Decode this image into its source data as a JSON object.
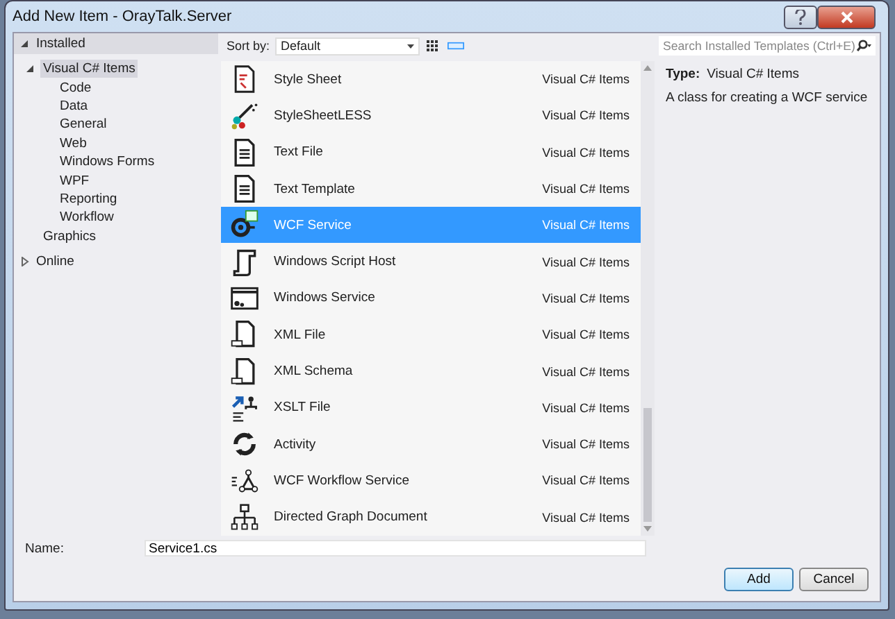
{
  "window": {
    "title": "Add New Item - OrayTalk.Server"
  },
  "sidebar": {
    "sections": [
      {
        "label": "Installed",
        "expanded": true,
        "items": [
          {
            "label": "Visual C# Items",
            "selected": true,
            "expanded": true,
            "children": [
              {
                "label": "Code",
                "selected": false
              },
              {
                "label": "Data",
                "selected": false
              },
              {
                "label": "General",
                "selected": false
              },
              {
                "label": "Web",
                "selected": false
              },
              {
                "label": "Windows Forms",
                "selected": false
              },
              {
                "label": "WPF",
                "selected": false
              },
              {
                "label": "Reporting",
                "selected": false
              },
              {
                "label": "Workflow",
                "selected": false
              }
            ]
          },
          {
            "label": "Graphics",
            "selected": false
          }
        ]
      },
      {
        "label": "Online",
        "expanded": false
      }
    ]
  },
  "toolbar": {
    "sort_label": "Sort by:",
    "sort_value": "Default",
    "views": [
      {
        "kind": "grid",
        "selected": false
      },
      {
        "kind": "list",
        "selected": true
      }
    ]
  },
  "search": {
    "placeholder": "Search Installed Templates (Ctrl+E)"
  },
  "templates": [
    {
      "name": "Style Sheet",
      "category": "Visual C# Items",
      "kind": "stylesheet",
      "selected": false
    },
    {
      "name": "StyleSheetLESS",
      "category": "Visual C# Items",
      "kind": "less",
      "selected": false
    },
    {
      "name": "Text File",
      "category": "Visual C# Items",
      "kind": "text",
      "selected": false
    },
    {
      "name": "Text Template",
      "category": "Visual C# Items",
      "kind": "text",
      "selected": false
    },
    {
      "name": "WCF Service",
      "category": "Visual C# Items",
      "kind": "wcf",
      "selected": true
    },
    {
      "name": "Windows Script Host",
      "category": "Visual C# Items",
      "kind": "script",
      "selected": false
    },
    {
      "name": "Windows Service",
      "category": "Visual C# Items",
      "kind": "service",
      "selected": false
    },
    {
      "name": "XML File",
      "category": "Visual C# Items",
      "kind": "xml",
      "selected": false
    },
    {
      "name": "XML Schema",
      "category": "Visual C# Items",
      "kind": "xml",
      "selected": false
    },
    {
      "name": "XSLT File",
      "category": "Visual C# Items",
      "kind": "xslt",
      "selected": false
    },
    {
      "name": "Activity",
      "category": "Visual C# Items",
      "kind": "activity",
      "selected": false
    },
    {
      "name": "WCF Workflow Service",
      "category": "Visual C# Items",
      "kind": "workflow",
      "selected": false
    },
    {
      "name": "Directed Graph Document",
      "category": "Visual C# Items",
      "kind": "graph",
      "selected": false
    }
  ],
  "details": {
    "type_label": "Type:",
    "type_value": "Visual C# Items",
    "description": "A class for creating a WCF service"
  },
  "name_field": {
    "label": "Name:",
    "value": "Service1.cs"
  },
  "buttons": [
    {
      "label": "Add",
      "default": true
    },
    {
      "label": "Cancel",
      "default": false
    }
  ]
}
